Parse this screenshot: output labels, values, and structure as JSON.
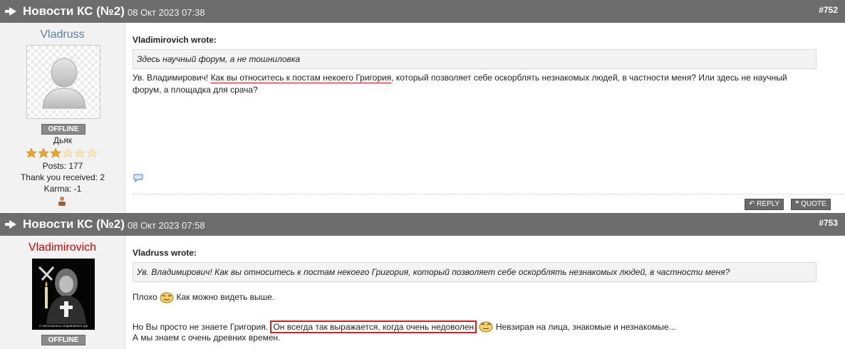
{
  "posts": [
    {
      "title": "Новости КС (№2)",
      "date": "08 Окт 2023 07:38",
      "number": "#752",
      "author": {
        "name": "Vladruss",
        "name_color": "#5b7fa6",
        "status": "OFFLINE",
        "rank": "Дьяк",
        "stars_filled": 3,
        "stars_total": 6,
        "posts": "Posts: 177",
        "thanks": "Thank you received: 2",
        "karma": "Karma: -1"
      },
      "quote_author": "Vladimirovich wrote:",
      "quote_text": "Здесь научный форум, а не тошниловка",
      "body": {
        "part1": "Ув. Владимирович! ",
        "underlined": "Как вы относитесь к постам некоего Григория",
        "part2": ", который позволяет себе оскорблять незнакомых людей, в частности меня? Или здесь не научный форум, а площадка для срача?"
      },
      "reply_label": "REPLY",
      "quote_label": "QUOTE"
    },
    {
      "title": "Новости КС (№2)",
      "date": "08 Окт 2023 07:58",
      "number": "#753",
      "author": {
        "name": "Vladimirovich",
        "name_color": "#e00000",
        "avatar_caption": "А несогласных отправляем в ад!",
        "status": "OFFLINE"
      },
      "quote_author": "Vladruss wrote:",
      "quote_text": "Ув. Владимирович! Как вы относитесь к постам некоего Григория, который позволяет себе оскорблять незнакомых людей, в частности меня?",
      "line1_a": "Плохо",
      "line1_b": "Как можно видеть выше.",
      "line2_a": "Но Вы просто не знаете Григория.",
      "line2_box": "Он всегда так выражается, когда очень недоволен",
      "line2_b": "Невзирая на лица, знакомые и незнакомые...",
      "line3": "А мы знаем с очень древних времен."
    }
  ],
  "colors": {
    "header_bg": "#6d6d6d",
    "accent_red": "#e21a1a",
    "button_bg": "#6a6a6a"
  },
  "icons": [
    "pin-icon",
    "default-avatar-icon",
    "star-icon",
    "chat-bubble-icon",
    "reply-arrow-icon",
    "quote-bubble-icon",
    "smiley-icon",
    "karma-icon"
  ]
}
